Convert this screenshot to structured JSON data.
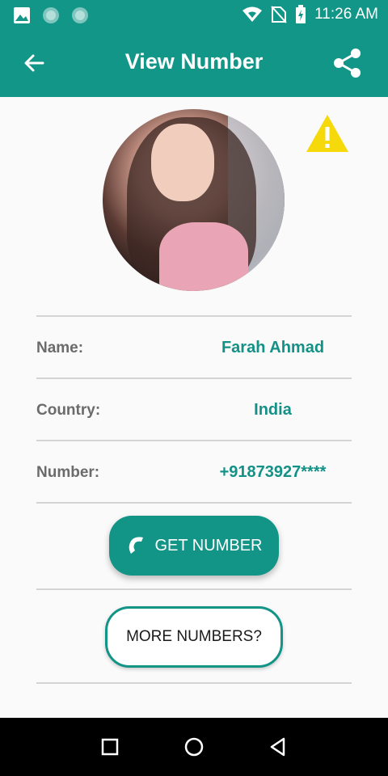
{
  "status_bar": {
    "time": "11:26 AM",
    "icons": [
      "image-icon",
      "circle-notification-icon",
      "circle-notification-icon",
      "wifi-icon",
      "no-sim-icon",
      "battery-charging-icon"
    ]
  },
  "app_bar": {
    "title": "View Number",
    "back_icon": "arrow-back-icon",
    "share_icon": "share-icon"
  },
  "profile": {
    "photo": "profile-photo",
    "warning_icon": "warning-icon"
  },
  "details": {
    "name_label": "Name:",
    "name_value": "Farah Ahmad",
    "country_label": "Country:",
    "country_value": "India",
    "number_label": "Number:",
    "number_value": "+91873927****"
  },
  "buttons": {
    "get_number": "GET NUMBER",
    "more_numbers": "MORE NUMBERS?"
  },
  "colors": {
    "primary": "#119688",
    "accent_text": "#149186",
    "label_text": "#6b6b6b",
    "warning": "#f5d90b"
  }
}
